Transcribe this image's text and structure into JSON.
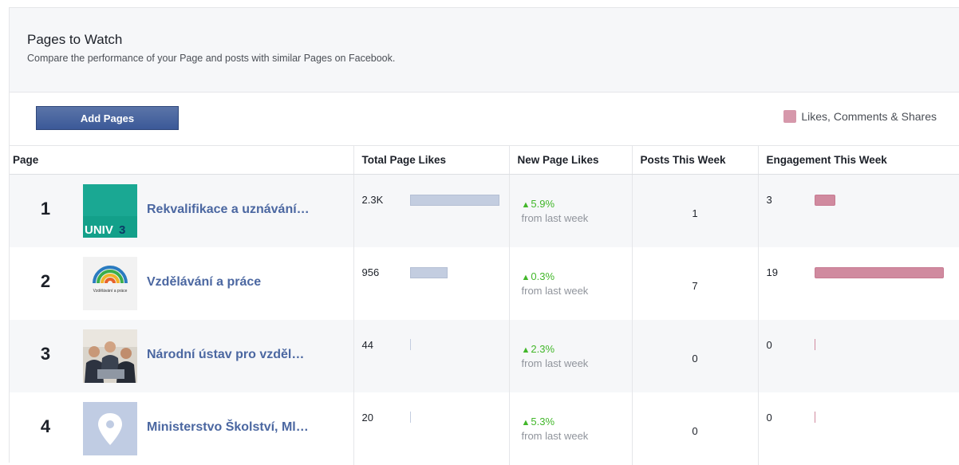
{
  "header": {
    "title": "Pages to Watch",
    "subtitle": "Compare the performance of your Page and posts with similar Pages on Facebook."
  },
  "toolbar": {
    "add_label": "Add Pages",
    "legend_label": "Likes, Comments & Shares",
    "legend_color": "#d698ab"
  },
  "columns": {
    "page": "Page",
    "total_likes": "Total Page Likes",
    "new_likes": "New Page Likes",
    "posts": "Posts This Week",
    "engagement": "Engagement This Week"
  },
  "rows": [
    {
      "rank": "1",
      "name": "Rekvalifikace a uznávání…",
      "thumb": "univ3-logo",
      "total_likes": "2.3K",
      "total_likes_value": 2300,
      "new_pct": "5.9%",
      "new_since": "from last week",
      "posts": "1",
      "engagement": "3",
      "engagement_value": 3
    },
    {
      "rank": "2",
      "name": "Vzdělávání a práce",
      "thumb": "vzdelavani-logo",
      "thumb_caption": "Vzdělávání a práce",
      "total_likes": "956",
      "total_likes_value": 956,
      "new_pct": "0.3%",
      "new_since": "from last week",
      "posts": "7",
      "engagement": "19",
      "engagement_value": 19
    },
    {
      "rank": "3",
      "name": "Národní ústav pro vzděl…",
      "thumb": "people-photo",
      "total_likes": "44",
      "total_likes_value": 44,
      "new_pct": "2.3%",
      "new_since": "from last week",
      "posts": "0",
      "engagement": "0",
      "engagement_value": 0
    },
    {
      "rank": "4",
      "name": "Ministerstvo Školství, Ml…",
      "thumb": "map-pin-placeholder",
      "total_likes": "20",
      "total_likes_value": 20,
      "new_pct": "5.3%",
      "new_since": "from last week",
      "posts": "0",
      "engagement": "0",
      "engagement_value": 0
    }
  ],
  "colors": {
    "accent": "#3b5998",
    "positive": "#42b72a",
    "likes_bar": "#c3cde0",
    "engagement_bar": "#d08a9f",
    "link": "#4b67a1"
  }
}
